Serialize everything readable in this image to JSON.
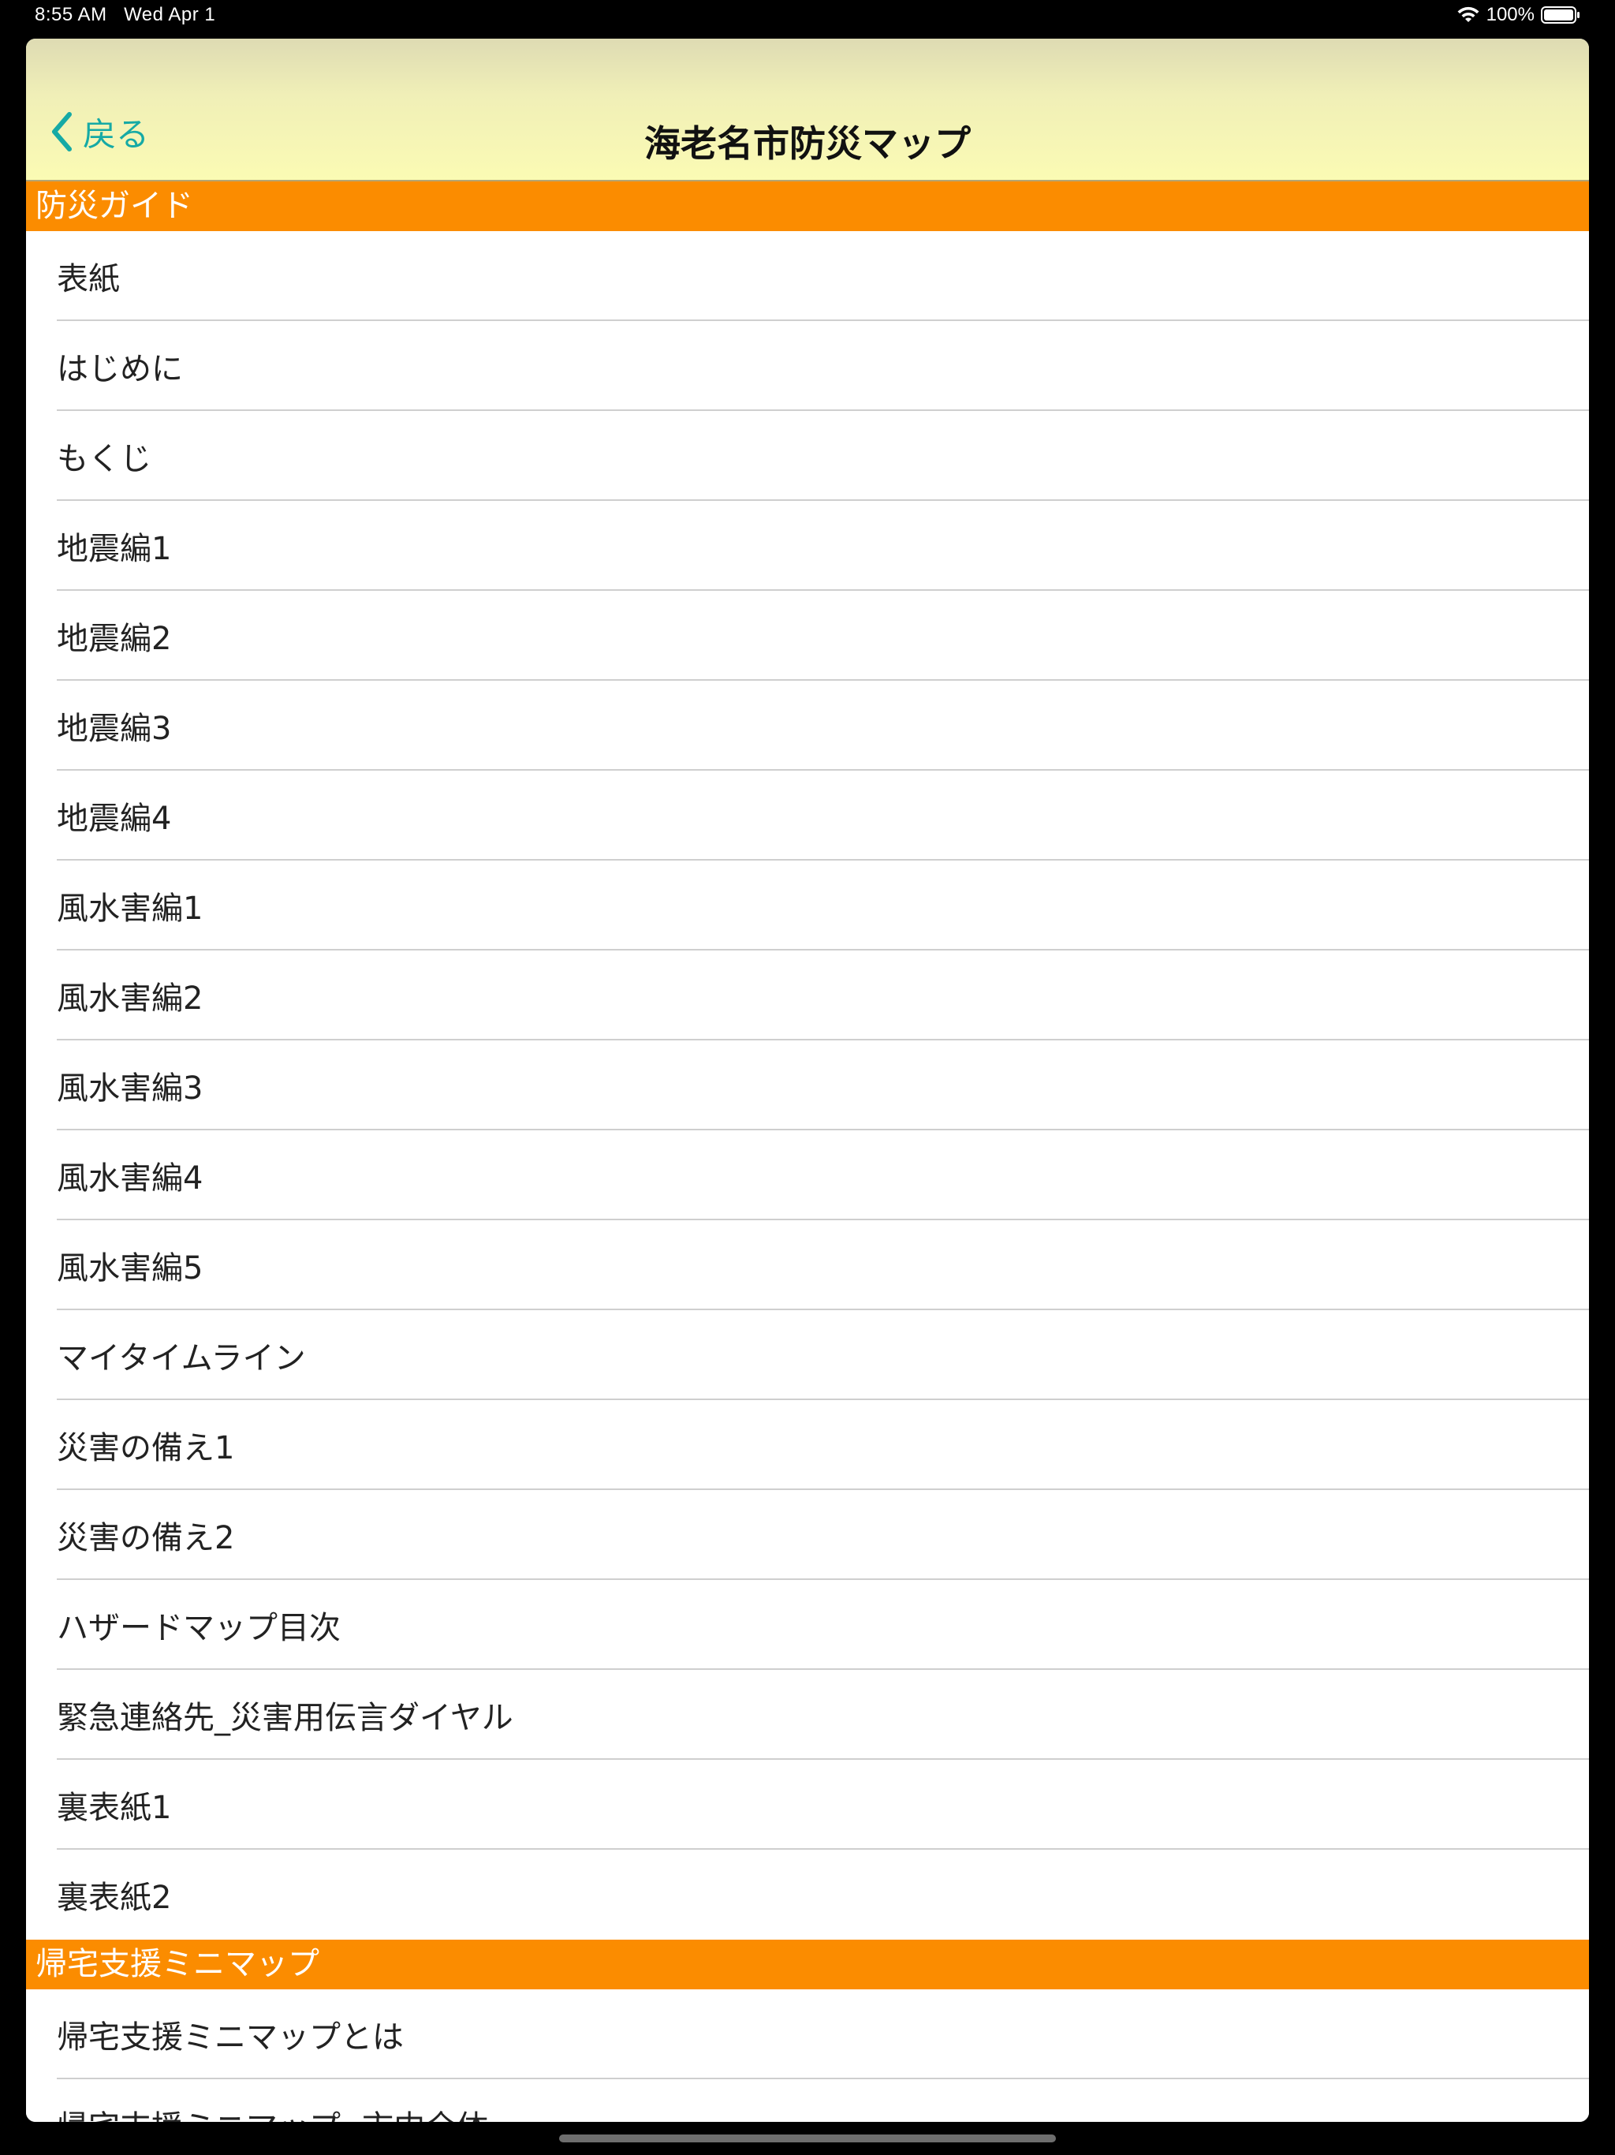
{
  "status_bar": {
    "time": "8:55 AM",
    "date": "Wed Apr 1",
    "battery": "100%",
    "icons": [
      "wifi-icon",
      "battery-icon"
    ]
  },
  "nav": {
    "back_label": "戻る",
    "title": "海老名市防災マップ",
    "accent": "#16aaa5"
  },
  "colors": {
    "section_header": "#fb8c00",
    "navbar": "#fbfbb4"
  },
  "sections": [
    {
      "title": "防災ガイド",
      "items": [
        "表紙",
        "はじめに",
        "もくじ",
        "地震編1",
        "地震編2",
        "地震編3",
        "地震編4",
        "風水害編1",
        "風水害編2",
        "風水害編3",
        "風水害編4",
        "風水害編5",
        "マイタイムライン",
        "災害の備え1",
        "災害の備え2",
        "ハザードマップ目次",
        "緊急連絡先_災害用伝言ダイヤル",
        "裏表紙1",
        "裏表紙2"
      ]
    },
    {
      "title": "帰宅支援ミニマップ",
      "items": [
        "帰宅支援ミニマップとは",
        "帰宅支援ミニマップ -市内全体-"
      ]
    }
  ]
}
